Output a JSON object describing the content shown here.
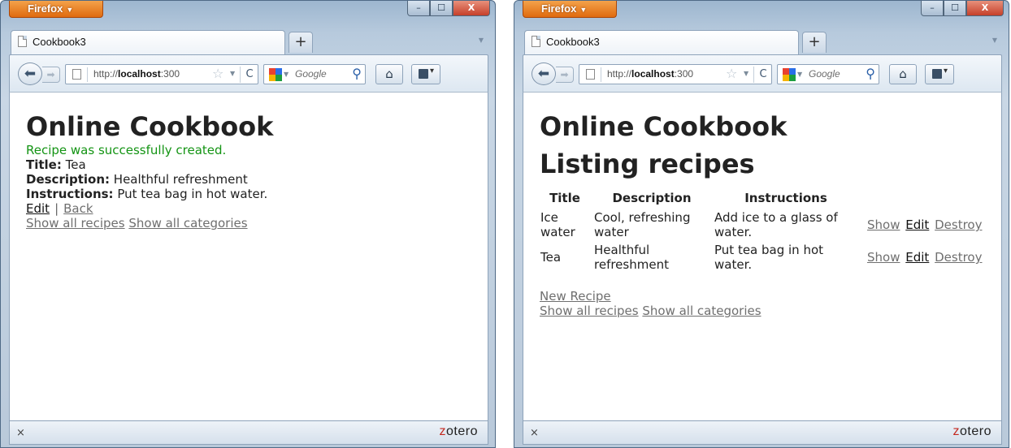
{
  "browser": {
    "firefox_label": "Firefox",
    "caption_buttons": {
      "minimize": "–",
      "maximize": "☐",
      "close": "X"
    },
    "tab_title": "Cookbook3",
    "new_tab": "+",
    "url_prefix": "http://",
    "url_host": "localhost",
    "url_rest": ":300",
    "search_placeholder": "Google",
    "status_close": "×",
    "zotero_first": "z",
    "zotero_rest": "otero"
  },
  "left_page": {
    "heading": "Online Cookbook",
    "notice": "Recipe was successfully created.",
    "title_label": "Title:",
    "title_value": "Tea",
    "description_label": "Description:",
    "description_value": "Healthful refreshment",
    "instructions_label": "Instructions:",
    "instructions_value": "Put tea bag in hot water.",
    "edit_link": "Edit",
    "separator": "|",
    "back_link": "Back",
    "show_all_recipes": "Show all recipes",
    "show_all_categories": "Show all categories"
  },
  "right_page": {
    "heading": "Online Cookbook",
    "subheading": "Listing recipes",
    "table": {
      "headers": [
        "Title",
        "Description",
        "Instructions"
      ],
      "rows": [
        {
          "title": "Ice water",
          "description": "Cool, refreshing water",
          "instructions": "Add ice to a glass of water.",
          "show": "Show",
          "edit": "Edit",
          "destroy": "Destroy"
        },
        {
          "title": "Tea",
          "description": "Healthful refreshment",
          "instructions": "Put tea bag in hot water.",
          "show": "Show",
          "edit": "Edit",
          "destroy": "Destroy"
        }
      ]
    },
    "new_recipe": "New Recipe",
    "show_all_recipes": "Show all recipes",
    "show_all_categories": "Show all categories"
  },
  "colors": {
    "notice_green": "#149414",
    "firefox_orange": "#e06b0f",
    "zotero_red": "#c4291f"
  }
}
